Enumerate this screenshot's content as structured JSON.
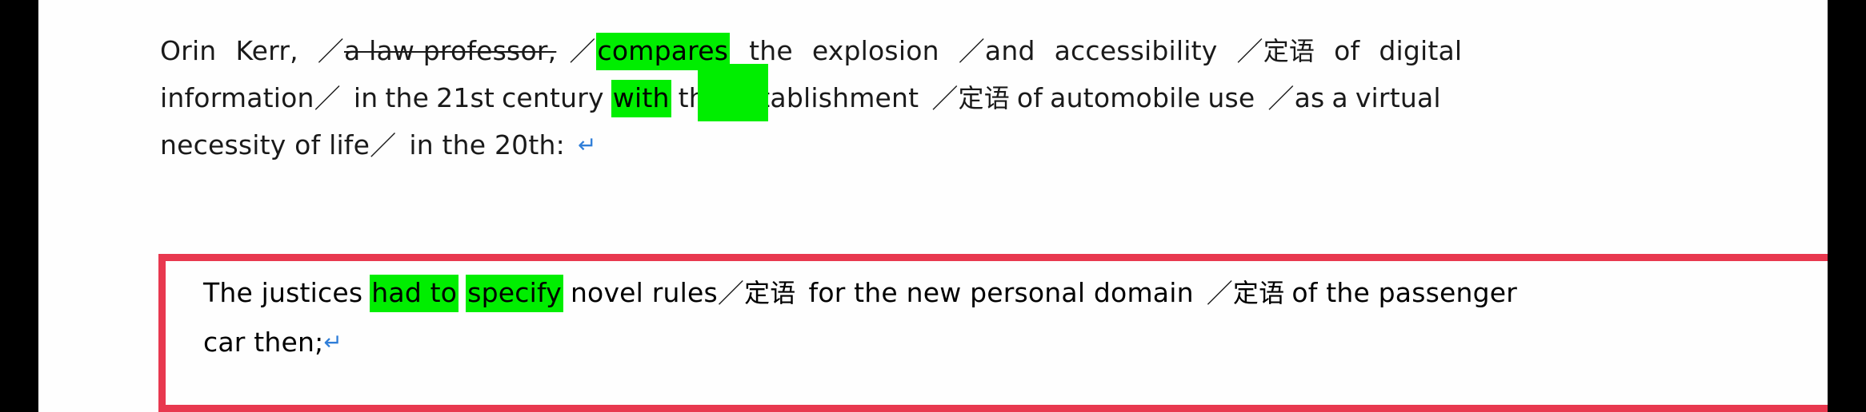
{
  "document": {
    "annotation_colors": {
      "highlight_green": "#00ee00",
      "box_red": "#e8384f",
      "return_mark_blue": "#2f7ed8",
      "text_black": "#1a1a1a",
      "page_background": "#fefefe",
      "letterbox_black": "#000000"
    },
    "paragraph_1": {
      "line_1": {
        "seg_1": "Orin",
        "seg_2": "Kerr,",
        "slash_1": "／",
        "struck_1": "a law professor,",
        "slash_2": "／",
        "highlight_1": "compares",
        "seg_3": "the",
        "seg_4": "explosion",
        "slash_3": "／",
        "seg_5": "and",
        "seg_6": "accessibility",
        "slash_4": "／",
        "cn_1": "定语",
        "seg_7": "of",
        "seg_8": "digital"
      },
      "line_2": {
        "seg_1": "information",
        "slash_1": "／",
        "seg_2": "in",
        "seg_3": "the",
        "seg_4": "21st",
        "seg_5": "century",
        "highlight_1": "with",
        "seg_6": "the",
        "seg_7": "establishment",
        "slash_2": "／",
        "cn_1": "定语",
        "seg_8": "of",
        "seg_9": "automobile",
        "seg_10": "use",
        "slash_3": "／",
        "seg_11": "as",
        "seg_12": "a",
        "seg_13": "virtual"
      },
      "line_3": {
        "seg_1": "necessity of life",
        "slash_1": "／",
        "seg_2": "in the 20th:",
        "return_mark": "↵"
      }
    },
    "paragraph_2_boxed": {
      "line_1": {
        "seg_1": "The justices",
        "highlight_1": "had to",
        "highlight_2": "specify",
        "seg_2": "novel rules",
        "slash_1": "／",
        "cn_1": "定语",
        "seg_3": "for the new personal domain",
        "slash_2": "／",
        "cn_2": "定语",
        "seg_4": "of the passenger"
      },
      "line_2": {
        "seg_1": "car then;",
        "return_mark": "↵"
      }
    }
  }
}
